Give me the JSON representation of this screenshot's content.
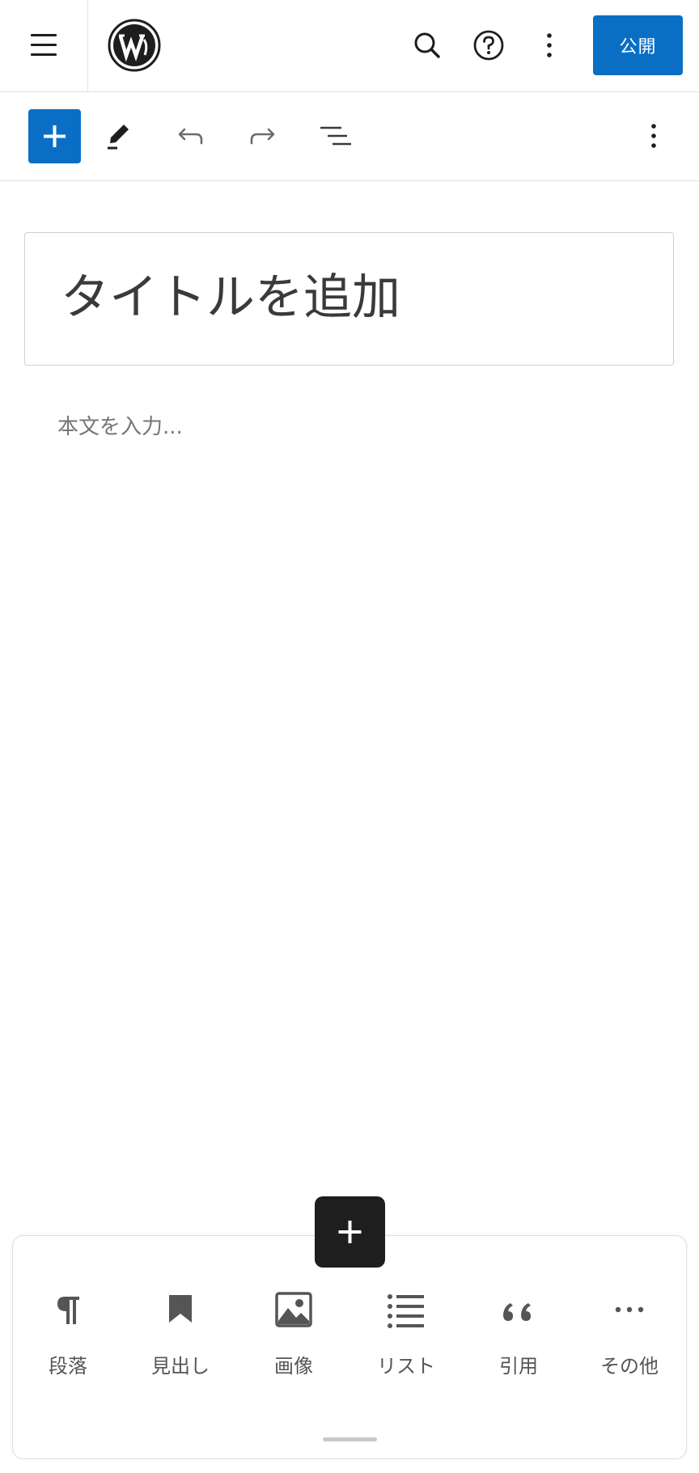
{
  "header": {
    "menu_icon": "hamburger-menu-icon",
    "logo_icon": "wordpress-logo",
    "search_icon": "search-icon",
    "help_icon": "help-icon",
    "more_icon": "more-vertical-icon",
    "publish_label": "公開"
  },
  "toolbar": {
    "add_block_icon": "plus-icon",
    "tools_icon": "pencil-icon",
    "undo_icon": "undo-icon",
    "redo_icon": "redo-icon",
    "outline_icon": "document-outline-icon",
    "options_icon": "more-vertical-icon"
  },
  "editor": {
    "title_placeholder": "タイトルを追加",
    "body_placeholder": "本文を入力..."
  },
  "quick_inserter": {
    "add_icon": "plus-icon",
    "blocks": [
      {
        "label": "段落",
        "icon": "paragraph-icon"
      },
      {
        "label": "見出し",
        "icon": "heading-bookmark-icon"
      },
      {
        "label": "画像",
        "icon": "image-icon"
      },
      {
        "label": "リスト",
        "icon": "list-icon"
      },
      {
        "label": "引用",
        "icon": "quote-icon"
      },
      {
        "label": "その他",
        "icon": "more-horizontal-icon"
      }
    ]
  },
  "colors": {
    "accent": "#0a6fc4",
    "dark": "#1e1e1e",
    "border": "#e0e0e0",
    "placeholder_text": "#757575"
  }
}
